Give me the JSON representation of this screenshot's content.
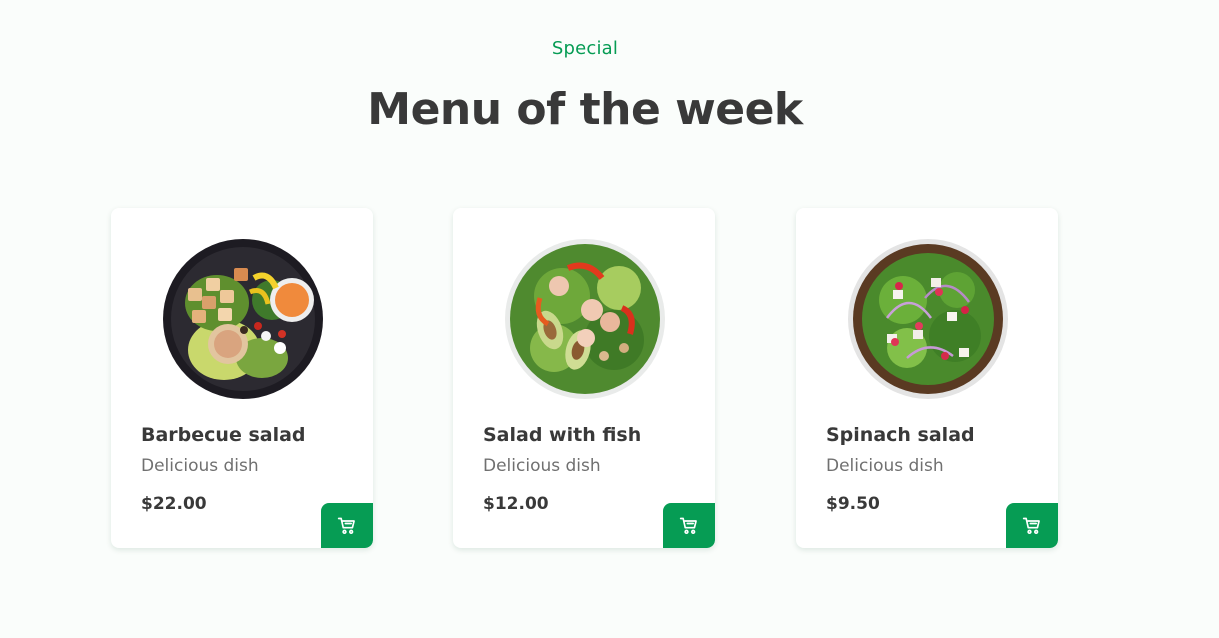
{
  "header": {
    "subtitle": "Special",
    "title": "Menu of the week"
  },
  "menu": {
    "items": [
      {
        "name": "Barbecue salad",
        "description": "Delicious dish",
        "price": "$22.00",
        "image": "barbecue-salad-bowl"
      },
      {
        "name": "Salad with fish",
        "description": "Delicious dish",
        "price": "$12.00",
        "image": "fish-salad-bowl"
      },
      {
        "name": "Spinach salad",
        "description": "Delicious dish",
        "price": "$9.50",
        "image": "spinach-salad-bowl"
      }
    ]
  },
  "colors": {
    "accent": "#069c54",
    "title": "#393939",
    "text_muted": "#707070",
    "background": "#fafdfb",
    "card": "#ffffff"
  },
  "icons": {
    "cart": "cart-icon"
  }
}
